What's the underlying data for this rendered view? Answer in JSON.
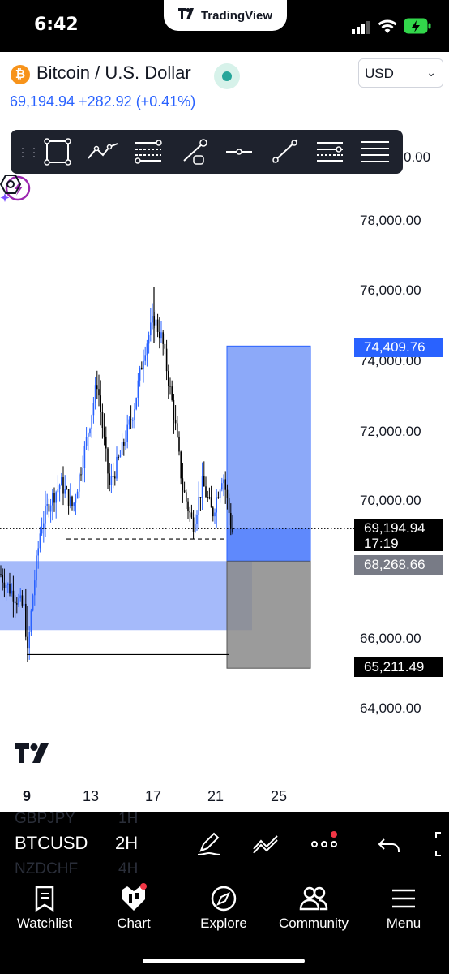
{
  "status_bar": {
    "time": "6:42",
    "app_name": "TradingView"
  },
  "header": {
    "symbol_title": "Bitcoin / U.S. Dollar",
    "price": "69,194.94",
    "change": "+282.92",
    "change_pct": "(+0.41%)",
    "currency": "USD",
    "up_color": "#2962ff"
  },
  "drawing_tools": [
    "rectangle-icon",
    "path-icon",
    "fib-retracement-icon",
    "trend-line-icon",
    "horizontal-line-icon",
    "ray-icon",
    "parallel-channel-icon",
    "more-lines-icon"
  ],
  "chart": {
    "price_axis": [
      "78,000.00",
      "76,000.00",
      "74,000.00",
      "72,000.00",
      "70,000.00",
      "66,000.00",
      "64,000.00"
    ],
    "top_label_partial": "0.00",
    "time_axis": [
      "9",
      "13",
      "17",
      "21",
      "25"
    ],
    "target_label": "74,409.76",
    "current_price": "69,194.94",
    "countdown": "17:19",
    "entry_label": "68,268.66",
    "stop_label": "65,211.49",
    "ylim": [
      63500,
      80500
    ],
    "long_position": {
      "entry": 68268.66,
      "target": 74409.76,
      "stop": 65211.49
    },
    "demand_zone": [
      66300,
      68268.66
    ],
    "colors": {
      "target_zone": "#6f93f7",
      "stop_zone": "#8a8a8a",
      "candle_up": "#2962ff",
      "candle_down": "#000000"
    }
  },
  "bottom_bar": {
    "ghost_symbols": [
      "GBPJPY",
      "NZDCHF"
    ],
    "symbol": "BTCUSD",
    "ghost_intervals": [
      "1H",
      "4H"
    ],
    "interval": "2H",
    "nav": [
      {
        "label": "Watchlist",
        "icon": "watchlist-icon"
      },
      {
        "label": "Chart",
        "icon": "chart-icon"
      },
      {
        "label": "Explore",
        "icon": "compass-icon"
      },
      {
        "label": "Community",
        "icon": "community-icon"
      },
      {
        "label": "Menu",
        "icon": "menu-icon"
      }
    ]
  }
}
